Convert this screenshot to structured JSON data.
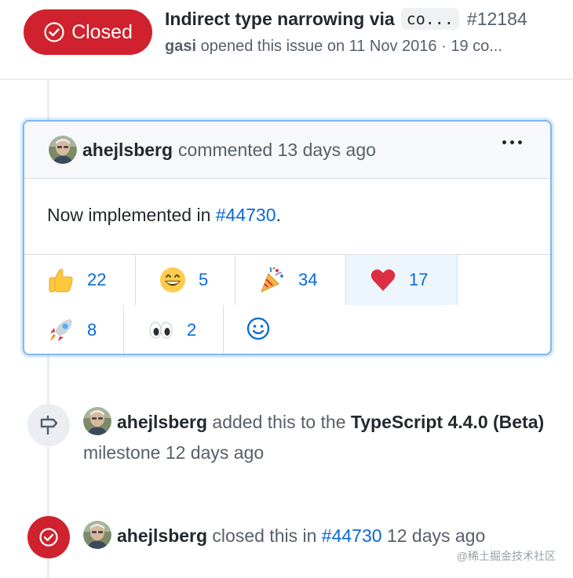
{
  "issue": {
    "state": "Closed",
    "title": "Indirect type narrowing via",
    "code_chip": "co...",
    "number": "#12184",
    "author": "gasi",
    "meta": "opened this issue on 11 Nov 2016 · 19 co..."
  },
  "comment": {
    "author": "ahejlsberg",
    "action": "commented 13 days ago",
    "body_prefix": "Now implemented in ",
    "body_link": "#44730",
    "body_suffix": ".",
    "reactions": [
      {
        "icon": "thumbs-up-icon",
        "count": "22",
        "active": false
      },
      {
        "icon": "laugh-icon",
        "count": "5",
        "active": false
      },
      {
        "icon": "hooray-icon",
        "count": "34",
        "active": false
      },
      {
        "icon": "heart-icon",
        "count": "17",
        "active": true
      },
      {
        "icon": "rocket-icon",
        "count": "8",
        "active": false
      },
      {
        "icon": "eyes-icon",
        "count": "2",
        "active": false
      }
    ]
  },
  "events": {
    "milestone": {
      "author": "ahejlsberg",
      "text1": " added this to the ",
      "milestone": "TypeScript 4.4.0 (Beta)",
      "text2": " milestone 12 days ago"
    },
    "closed": {
      "author": "ahejlsberg",
      "text1": " closed this in ",
      "link": "#44730",
      "text2": " 12 days ago"
    }
  },
  "watermark": "@稀土掘金技术社区",
  "colors": {
    "closed_red": "#cf222e",
    "link_blue": "#0969da",
    "card_border": "#80b6f0"
  }
}
